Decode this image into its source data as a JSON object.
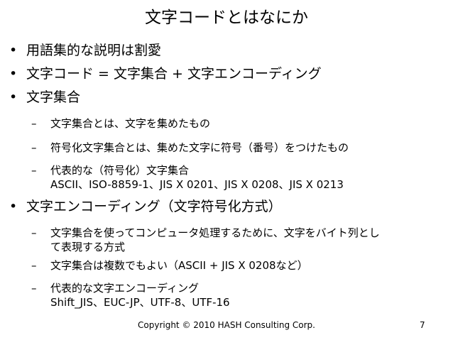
{
  "slide": {
    "title": "文字コードとはなにか",
    "items": [
      {
        "bullet": "•",
        "text": "用語集的な説明は割愛"
      },
      {
        "bullet": "•",
        "text": "文字コード = 文字集合 + 文字エンコーディング"
      },
      {
        "bullet": "•",
        "text": "文字集合",
        "sub": [
          {
            "dash": "–",
            "line1": "文字集合とは、文字を集めたもの"
          },
          {
            "dash": "–",
            "line1": "符号化文字集合とは、集めた文字に符号（番号）をつけたもの"
          },
          {
            "dash": "–",
            "line1": "代表的な（符号化）文字集合",
            "line2": "ASCII、ISO-8859-1、JIS X 0201、JIS X 0208、JIS X 0213"
          }
        ]
      },
      {
        "bullet": "•",
        "text": "文字エンコーディング（文字符号化方式）",
        "sub": [
          {
            "dash": "–",
            "line1": "文字集合を使ってコンピュータ処理するために、文字をバイト列とし",
            "line2": "て表現する方式"
          },
          {
            "dash": "–",
            "line1": "文字集合は複数でもよい（ASCII + JIS X 0208など）"
          },
          {
            "dash": "–",
            "line1": "代表的な文字エンコーディング",
            "line2": "Shift_JIS、EUC-JP、UTF-8、UTF-16"
          }
        ]
      }
    ],
    "footer": "Copyright © 2010 HASH Consulting Corp.",
    "page_number": "7"
  }
}
